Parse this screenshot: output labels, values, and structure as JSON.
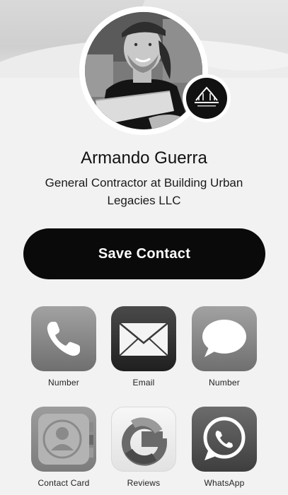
{
  "profile": {
    "name": "Armando Guerra",
    "title": "General Contractor at Building Urban Legacies LLC"
  },
  "actions": {
    "save_label": "Save Contact"
  },
  "tiles": [
    {
      "label": "Number",
      "icon": "phone-icon"
    },
    {
      "label": "Email",
      "icon": "envelope-icon"
    },
    {
      "label": "Number",
      "icon": "message-bubble-icon"
    },
    {
      "label": "Contact Card",
      "icon": "contact-card-icon"
    },
    {
      "label": "Reviews",
      "icon": "google-icon"
    },
    {
      "label": "WhatsApp",
      "icon": "whatsapp-icon"
    }
  ],
  "colors": {
    "button_bg": "#0a0a0a",
    "page_bg": "#f2f2f2"
  }
}
